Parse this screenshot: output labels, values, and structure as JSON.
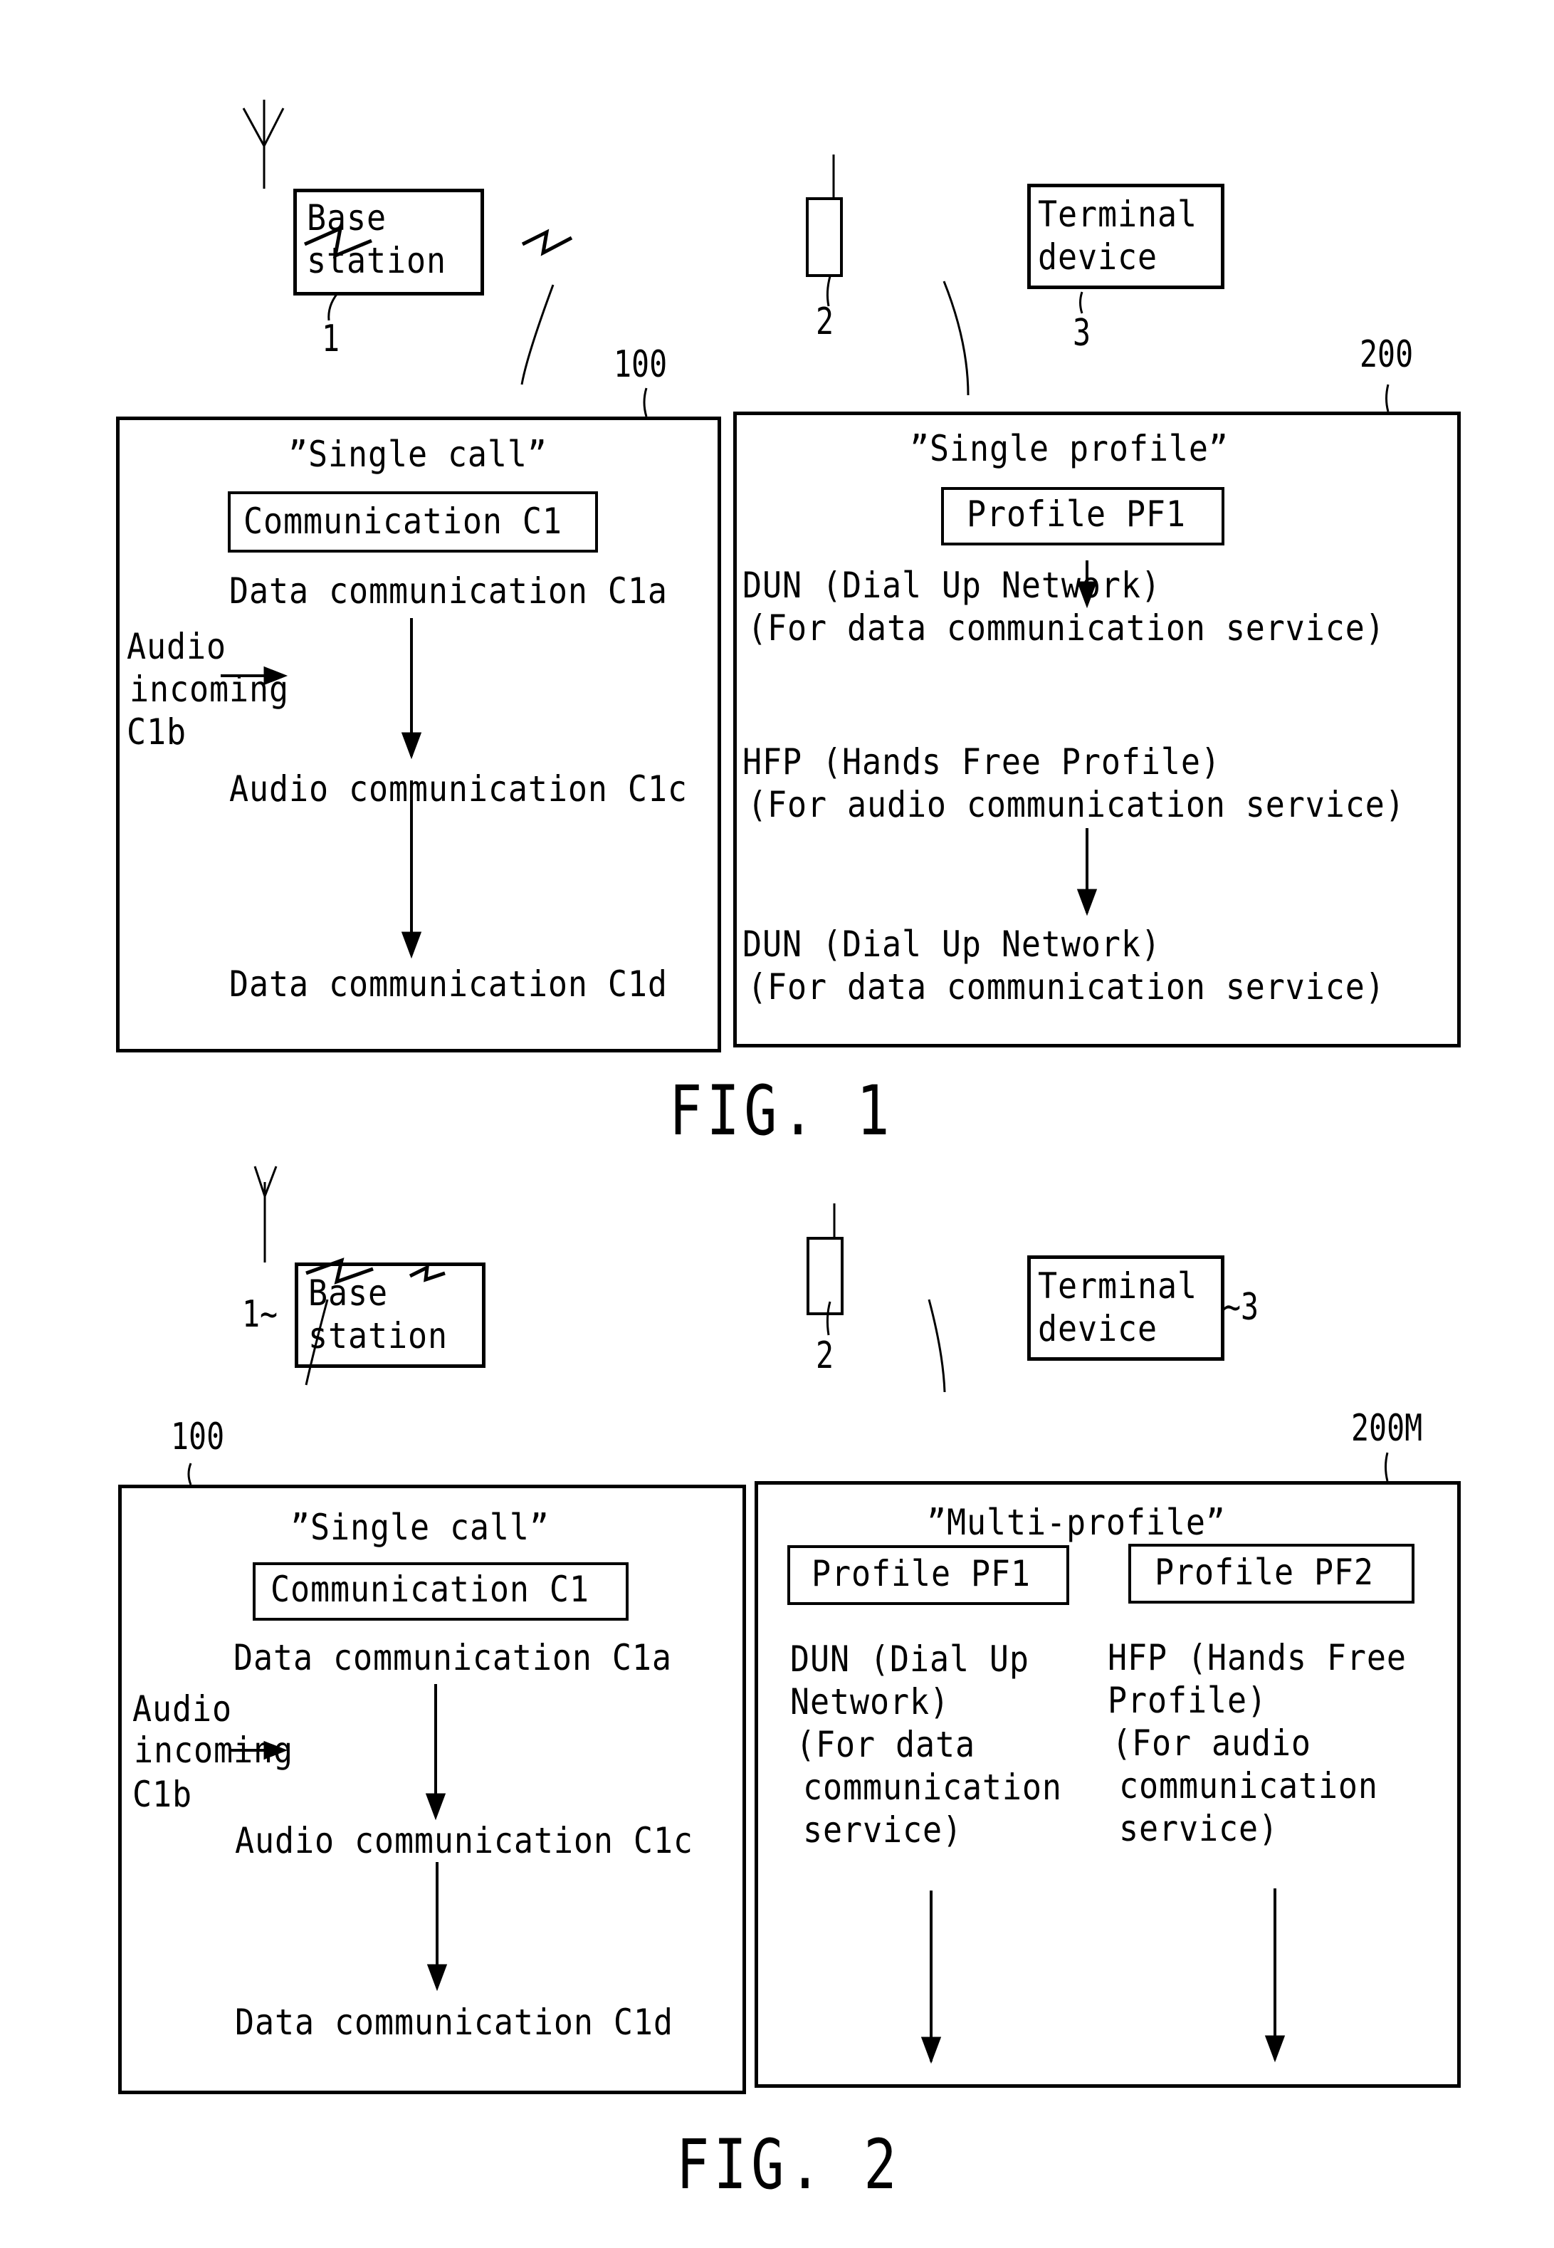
{
  "fig1": {
    "label": "FIG. 1",
    "base_station": {
      "line1": "Base",
      "line2": "station",
      "ref": "1"
    },
    "relay": {
      "ref": "2"
    },
    "terminal": {
      "line1": "Terminal",
      "line2": "device",
      "ref": "3"
    },
    "left_panel": {
      "ref": "100",
      "title": "”Single call”",
      "box_label": "Communication C1",
      "step_a": "Data communication C1a",
      "incoming": [
        "Audio",
        "incoming",
        "C1b"
      ],
      "step_c": "Audio communication C1c",
      "step_d": "Data communication C1d"
    },
    "right_panel": {
      "ref": "200",
      "title": "”Single profile”",
      "box_label": "Profile PF1",
      "items": [
        {
          "line1": "DUN (Dial Up Network)",
          "line2": "(For data communication service)"
        },
        {
          "line1": "HFP (Hands Free Profile)",
          "line2": "(For audio communication service)"
        },
        {
          "line1": "DUN (Dial Up Network)",
          "line2": "(For data communication service)"
        }
      ]
    }
  },
  "fig2": {
    "label": "FIG. 2",
    "base_station": {
      "line1": "Base",
      "line2": "station",
      "ref": "1~"
    },
    "relay": {
      "ref": "2"
    },
    "terminal": {
      "line1": "Terminal",
      "line2": "device",
      "ref": "~3"
    },
    "left_panel": {
      "ref": "100",
      "title": "”Single call”",
      "box_label": "Communication C1",
      "step_a": "Data communication C1a",
      "incoming": [
        "Audio",
        "incoming",
        "C1b"
      ],
      "step_c": "Audio communication C1c",
      "step_d": "Data communication C1d"
    },
    "right_panel": {
      "ref": "200M",
      "title": "”Multi-profile”",
      "profiles": [
        {
          "box_label": "Profile PF1",
          "lines": [
            "DUN (Dial Up",
            "Network)",
            "(For data",
            " communication",
            " service)"
          ]
        },
        {
          "box_label": "Profile PF2",
          "lines": [
            "HFP (Hands Free",
            "Profile)",
            "(For audio",
            " communication",
            " service)"
          ]
        }
      ]
    }
  }
}
